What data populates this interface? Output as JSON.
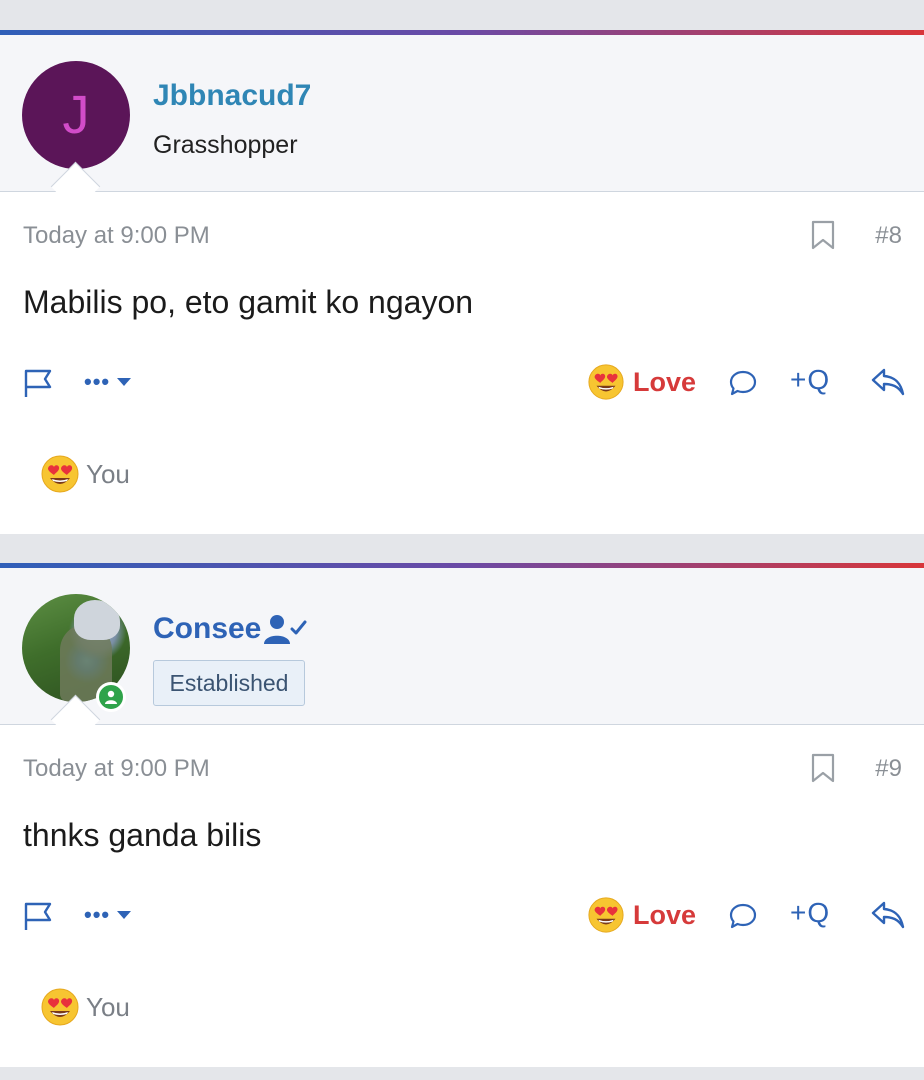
{
  "posts": [
    {
      "avatar_letter": "J",
      "username": "Jbbnacud7",
      "user_title": "Grasshopper",
      "timestamp": "Today at 9:00 PM",
      "post_number": "#8",
      "message": "Mabilis po, eto gamit ko ngayon",
      "reaction_label": "Love",
      "quote_label": "+Q",
      "reaction_summary": "You"
    },
    {
      "avatar_icon": "avatar-photo",
      "username": "Consee",
      "user_banner": "Established",
      "timestamp": "Today at 9:00 PM",
      "post_number": "#9",
      "message": "thnks ganda bilis",
      "reaction_label": "Love",
      "quote_label": "+Q",
      "reaction_summary": "You"
    }
  ],
  "colors": {
    "accent_gradient": [
      "#2f5fb8",
      "#6a4aa6",
      "#d8363a"
    ],
    "link_blue": "#2e63b6",
    "love_red": "#d63a3a",
    "avatar_bg": "#5b1558",
    "online_green": "#2fa34a"
  }
}
